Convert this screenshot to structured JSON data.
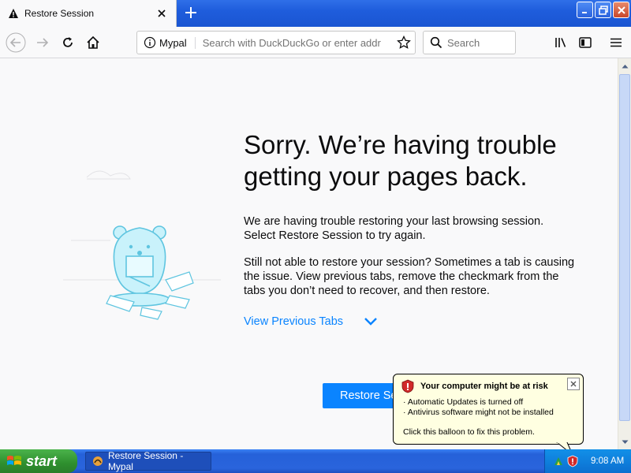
{
  "browser": {
    "tab_title": "Restore Session",
    "site_label": "Mypal",
    "url_placeholder": "Search with DuckDuckGo or enter addr",
    "search_placeholder": "Search"
  },
  "page": {
    "heading_line1": "Sorry. We’re having trouble",
    "heading_line2": "getting your pages back.",
    "para1_line1": "We are having trouble restoring your last browsing session.",
    "para1_line2": "Select Restore Session to try again.",
    "para2_line1": "Still not able to restore your session? Sometimes a tab is causing",
    "para2_line2": "the issue. View previous tabs, remove the checkmark from the",
    "para2_line3": "tabs you don’t need to recover, and then restore.",
    "view_previous_tabs": "View Previous Tabs",
    "restore_button": "Restore Session"
  },
  "balloon": {
    "title": "Your computer might be at risk",
    "line1": "· Automatic Updates is turned off",
    "line2": "· Antivirus software might not be installed",
    "line3": "Click this balloon to fix this problem."
  },
  "taskbar": {
    "start": "start",
    "task_item": "Restore Session - Mypal",
    "clock": "9:08 AM"
  },
  "colors": {
    "accent": "#0a84ff",
    "xp_blue": "#2561d9",
    "start_green": "#3aa53a",
    "balloon_bg": "#ffffe1"
  }
}
